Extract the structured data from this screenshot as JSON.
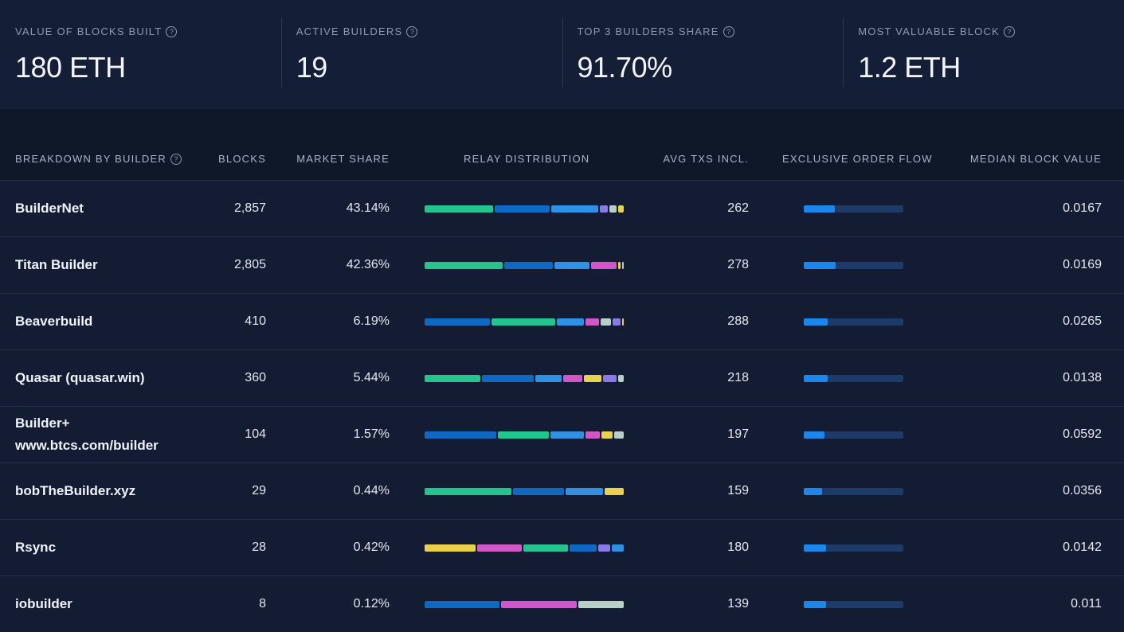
{
  "stats": [
    {
      "label": "VALUE OF BLOCKS BUILT",
      "value": "180 ETH"
    },
    {
      "label": "ACTIVE BUILDERS",
      "value": "19"
    },
    {
      "label": "TOP 3 BUILDERS SHARE",
      "value": "91.70%"
    },
    {
      "label": "MOST VALUABLE BLOCK",
      "value": "1.2 ETH"
    }
  ],
  "table": {
    "headers": {
      "builder": "BREAKDOWN BY BUILDER",
      "blocks": "BLOCKS",
      "market_share": "MARKET SHARE",
      "relay": "RELAY DISTRIBUTION",
      "avg_txs": "AVG TXS INCL.",
      "efo": "EXCLUSIVE ORDER FLOW",
      "median": "MEDIAN BLOCK VALUE"
    },
    "rows": [
      {
        "name": "BuilderNet",
        "blocks": "2,857",
        "share": "43.14%",
        "avg_txs": "262",
        "median": "0.0167",
        "efo_fraction": 0.31,
        "relay": [
          {
            "c": "#24c48e",
            "w": 35
          },
          {
            "c": "#0f68c2",
            "w": 28
          },
          {
            "c": "#3090e3",
            "w": 24
          },
          {
            "c": "#8a79e8",
            "w": 4
          },
          {
            "c": "#b8cfc8",
            "w": 3.5
          },
          {
            "c": "#e8d14f",
            "w": 3
          }
        ]
      },
      {
        "name": "Titan Builder",
        "blocks": "2,805",
        "share": "42.36%",
        "avg_txs": "278",
        "median": "0.0169",
        "efo_fraction": 0.32,
        "relay": [
          {
            "c": "#24c48e",
            "w": 40
          },
          {
            "c": "#0f68c2",
            "w": 25
          },
          {
            "c": "#3090e3",
            "w": 18
          },
          {
            "c": "#d157c8",
            "w": 13
          },
          {
            "c": "#e8d14f",
            "w": 1
          },
          {
            "c": "#b8cfc8",
            "w": 1
          }
        ]
      },
      {
        "name": "Beaverbuild",
        "blocks": "410",
        "share": "6.19%",
        "avg_txs": "288",
        "median": "0.0265",
        "efo_fraction": 0.24,
        "relay": [
          {
            "c": "#0f68c2",
            "w": 34
          },
          {
            "c": "#24c48e",
            "w": 33
          },
          {
            "c": "#3090e3",
            "w": 14
          },
          {
            "c": "#d157c8",
            "w": 7
          },
          {
            "c": "#b8cfc8",
            "w": 5.5
          },
          {
            "c": "#8a79e8",
            "w": 4
          },
          {
            "c": "#e8d14f",
            "w": 0.8
          }
        ]
      },
      {
        "name": "Quasar (quasar.win)",
        "blocks": "360",
        "share": "5.44%",
        "avg_txs": "218",
        "median": "0.0138",
        "efo_fraction": 0.24,
        "relay": [
          {
            "c": "#24c48e",
            "w": 29
          },
          {
            "c": "#0f68c2",
            "w": 27
          },
          {
            "c": "#3090e3",
            "w": 14
          },
          {
            "c": "#d157c8",
            "w": 10
          },
          {
            "c": "#e8d14f",
            "w": 9
          },
          {
            "c": "#8a79e8",
            "w": 7
          },
          {
            "c": "#b8cfc8",
            "w": 3
          }
        ]
      },
      {
        "name": "Builder+ www.btcs.com/builder",
        "blocks": "104",
        "share": "1.57%",
        "avg_txs": "197",
        "median": "0.0592",
        "efo_fraction": 0.21,
        "relay": [
          {
            "c": "#0f68c2",
            "w": 36
          },
          {
            "c": "#24c48e",
            "w": 26
          },
          {
            "c": "#3090e3",
            "w": 17
          },
          {
            "c": "#d157c8",
            "w": 7
          },
          {
            "c": "#e8d14f",
            "w": 5.5
          },
          {
            "c": "#b8cfc8",
            "w": 5
          }
        ]
      },
      {
        "name": "bobTheBuilder.xyz",
        "blocks": "29",
        "share": "0.44%",
        "avg_txs": "159",
        "median": "0.0356",
        "efo_fraction": 0.18,
        "relay": [
          {
            "c": "#24c48e",
            "w": 44
          },
          {
            "c": "#0f68c2",
            "w": 26
          },
          {
            "c": "#3090e3",
            "w": 19
          },
          {
            "c": "#e8d14f",
            "w": 9.5
          }
        ]
      },
      {
        "name": "Rsync",
        "blocks": "28",
        "share": "0.42%",
        "avg_txs": "180",
        "median": "0.0142",
        "efo_fraction": 0.22,
        "relay": [
          {
            "c": "#e8d14f",
            "w": 26
          },
          {
            "c": "#d157c8",
            "w": 22.5
          },
          {
            "c": "#24c48e",
            "w": 22.5
          },
          {
            "c": "#0f68c2",
            "w": 14
          },
          {
            "c": "#8a79e8",
            "w": 6
          },
          {
            "c": "#3090e3",
            "w": 6
          }
        ]
      },
      {
        "name": "iobuilder",
        "blocks": "8",
        "share": "0.12%",
        "avg_txs": "139",
        "median": "0.011",
        "efo_fraction": 0.22,
        "relay": [
          {
            "c": "#0f68c2",
            "w": 38
          },
          {
            "c": "#d157c8",
            "w": 38
          },
          {
            "c": "#b8cfc8",
            "w": 23
          }
        ]
      }
    ]
  }
}
